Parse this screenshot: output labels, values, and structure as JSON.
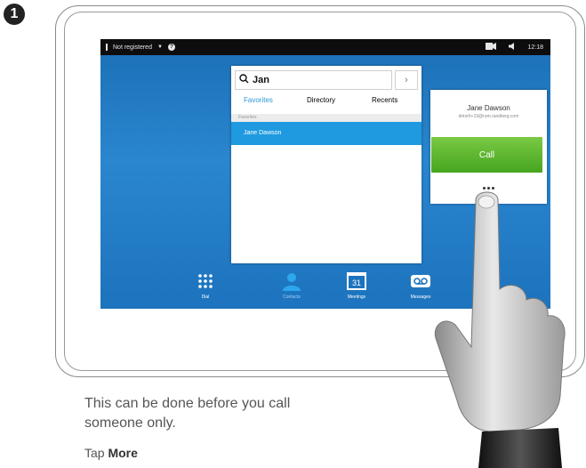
{
  "step_number": "1",
  "status_bar": {
    "registration": "Not registered",
    "time": "12:18"
  },
  "search": {
    "value": "Jan",
    "go": "›"
  },
  "tabs": [
    "Favorites",
    "Directory",
    "Recents"
  ],
  "favorites_header": "Favorites",
  "contact": {
    "name": "Jane Dawson",
    "address": "dntsrh+19@rum.randtwrg.com"
  },
  "call_label": "Call",
  "nav": [
    {
      "label": "Dial",
      "icon": "dialpad-icon"
    },
    {
      "label": "Contacts",
      "icon": "contacts-icon"
    },
    {
      "label": "Meetings",
      "icon": "calendar-icon",
      "badge": "31"
    },
    {
      "label": "Messages",
      "icon": "voicemail-icon"
    }
  ],
  "caption": {
    "line1": "This can be done before you call",
    "line2": "someone only.",
    "instruction_prefix": "Tap ",
    "instruction_bold": "More"
  },
  "colors": {
    "screen_blue": "#1f7dc6",
    "highlight_blue": "#1f9ae0",
    "call_green": "#47a520"
  }
}
